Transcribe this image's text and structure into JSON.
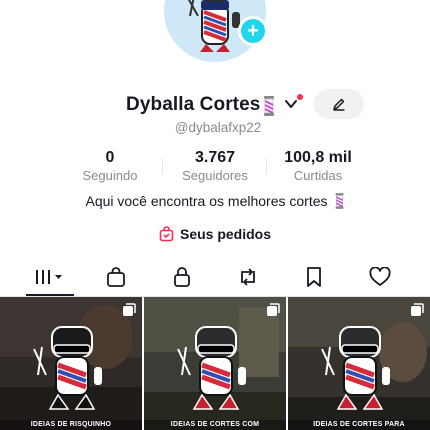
{
  "profile": {
    "display_name": "Dyballa Cortes",
    "handle": "@dybalafxp22",
    "add_icon": "plus-icon",
    "accent_color": "#20d5ec",
    "notification_color": "#fe2c55"
  },
  "stats": [
    {
      "value": "0",
      "label": "Seguindo"
    },
    {
      "value": "3.767",
      "label": "Seguidores"
    },
    {
      "value": "100,8 mil",
      "label": "Curtidas"
    }
  ],
  "bio": "Aqui você encontra os melhores cortes",
  "orders": {
    "label": "Seus pedidos",
    "icon": "shopping-bag-icon"
  },
  "tabs": [
    {
      "name": "videos",
      "icon": "grid-icon",
      "selected": true
    },
    {
      "name": "shop",
      "icon": "shopping-bag-icon"
    },
    {
      "name": "private",
      "icon": "lock-icon"
    },
    {
      "name": "reposts",
      "icon": "repost-icon"
    },
    {
      "name": "favorites",
      "icon": "bookmark-icon"
    },
    {
      "name": "liked",
      "icon": "heart-icon"
    }
  ],
  "videos": [
    {
      "caption": "IDEIAS DE RISQUINHO",
      "icon": "multi-photo-icon"
    },
    {
      "caption": "IDEIAS DE CORTES COM",
      "icon": "multi-photo-icon"
    },
    {
      "caption": "IDEIAS DE CORTES PARA",
      "icon": "multi-photo-icon"
    }
  ]
}
